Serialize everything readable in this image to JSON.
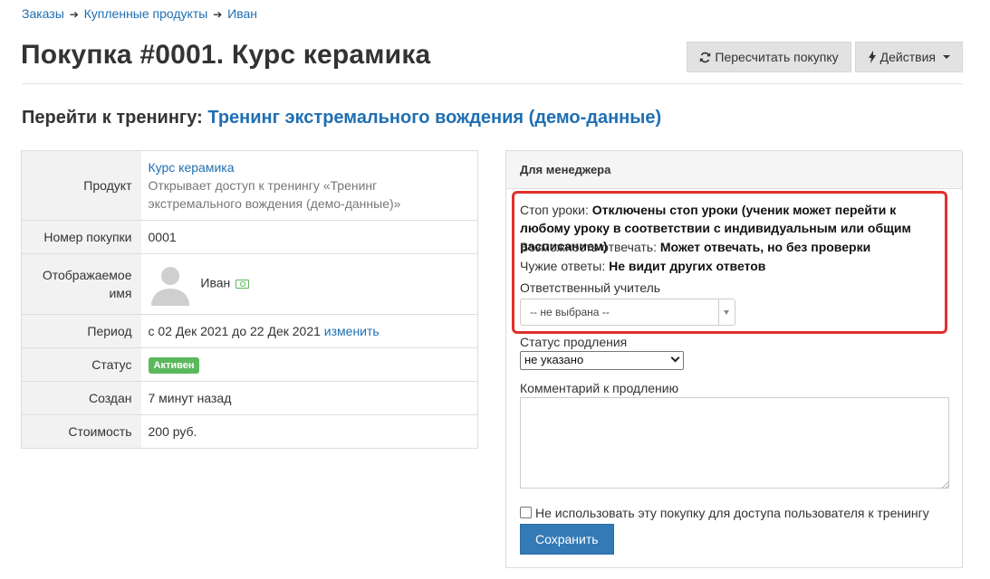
{
  "breadcrumb": {
    "items": [
      "Заказы",
      "Купленные продукты",
      "Иван"
    ]
  },
  "page": {
    "title": "Покупка #0001. Курс керамика"
  },
  "buttons": {
    "recalc": "Пересчитать покупку",
    "actions": "Действия"
  },
  "goto": {
    "label": "Перейти к тренингу:",
    "link": "Тренинг экстремального вождения (демо-данные)"
  },
  "info": {
    "product_key": "Продукт",
    "product_link": "Курс керамика",
    "product_desc": "Открывает доступ к тренингу «Тренинг экстремального вождения (демо-данные)»",
    "number_key": "Номер покупки",
    "number_val": "0001",
    "display_key": "Отображаемое имя",
    "display_name": "Иван",
    "period_key": "Период",
    "period_val": "с 02 Дек 2021 до 22 Дек 2021",
    "period_change": "изменить",
    "status_key": "Статус",
    "status_badge": "Активен",
    "created_key": "Создан",
    "created_val": "7 минут назад",
    "cost_key": "Стоимость",
    "cost_val": "200 руб."
  },
  "manager": {
    "title": "Для менеджера",
    "stop_label": "Стоп уроки:",
    "stop_val": "Отключены стоп уроки (ученик может перейти к любому уроку в соответствии с индивидуальным или общим расписанием)",
    "answer_label": "Возможность отвечать:",
    "answer_val": "Может отвечать, но без проверки",
    "others_label": "Чужие ответы:",
    "others_val": "Не видит других ответов",
    "teacher_label": "Ответственный учитель",
    "teacher_value": "-- не выбрана --",
    "renew_label": "Статус продления",
    "renew_value": "не указано",
    "comment_label": "Комментарий к продлению",
    "comment_value": "",
    "checkbox_label": "Не использовать эту покупку для доступа пользователя к тренингу",
    "save": "Сохранить"
  },
  "colors": {
    "link": "#1f6fb2",
    "primary": "#337ab7",
    "success": "#5cb85c",
    "highlight": "#e0312c"
  }
}
